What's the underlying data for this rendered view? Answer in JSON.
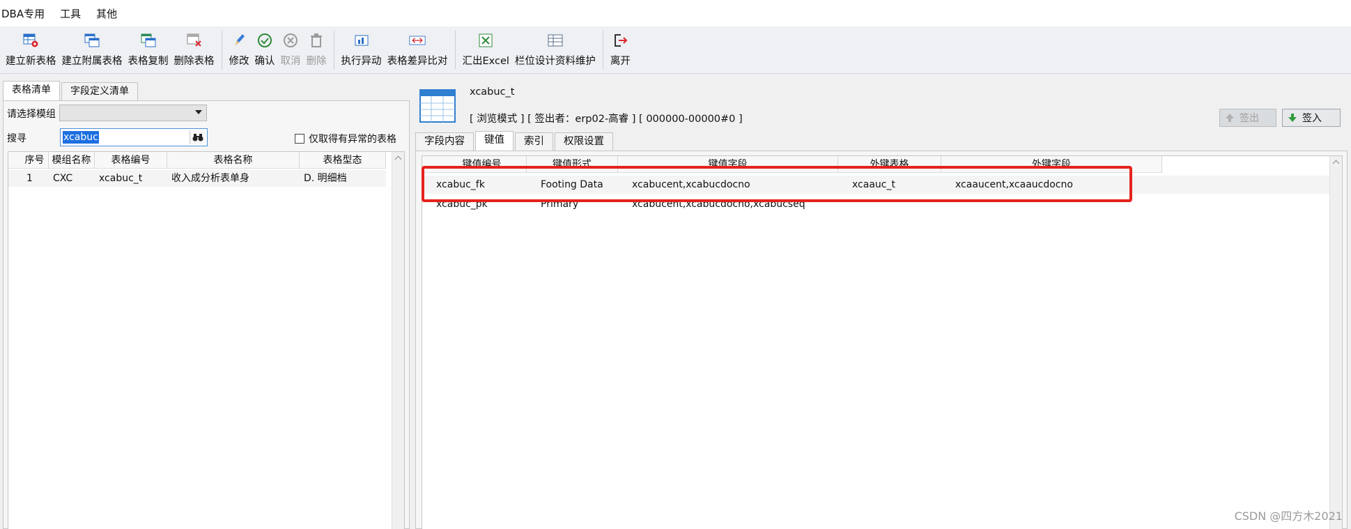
{
  "menu": [
    "DBA专用",
    "工具",
    "其他"
  ],
  "toolbar": {
    "groups": [
      [
        {
          "label": "建立新表格",
          "icon": "table-add-icon"
        },
        {
          "label": "建立附属表格",
          "icon": "table-attach-icon"
        },
        {
          "label": "表格复制",
          "icon": "table-copy-icon"
        },
        {
          "label": "删除表格",
          "icon": "table-delete-icon"
        }
      ],
      [
        {
          "label": "修改",
          "icon": "pencil-icon"
        },
        {
          "label": "确认",
          "icon": "check-icon"
        },
        {
          "label": "取消",
          "icon": "cancel-icon",
          "disabled": true
        },
        {
          "label": "删除",
          "icon": "trash-icon",
          "disabled": true
        }
      ],
      [
        {
          "label": "执行异动",
          "icon": "execute-icon"
        },
        {
          "label": "表格差异比对",
          "icon": "compare-icon"
        }
      ],
      [
        {
          "label": "汇出Excel",
          "icon": "excel-icon"
        },
        {
          "label": "栏位设计资料维护",
          "icon": "field-design-icon"
        }
      ],
      [
        {
          "label": "离开",
          "icon": "exit-icon"
        }
      ]
    ]
  },
  "left": {
    "tabs": [
      "表格清单",
      "字段定义清单"
    ],
    "module_label": "请选择模组",
    "module_value": "",
    "search_label": "搜寻",
    "search_value": "xcabuc",
    "abnormal_only_label": "仅取得有异常的表格",
    "abnormal_only_checked": false,
    "columns": [
      "序号",
      "模组名称",
      "表格编号",
      "表格名称",
      "表格型态"
    ],
    "rows": [
      [
        "1",
        "CXC",
        "xcabuc_t",
        "收入成分析表单身",
        "D. 明细档"
      ]
    ]
  },
  "right": {
    "table_name": "xcabuc_t",
    "status": "[ 浏览模式 ] [ 签出者：erp02-高睿 ] [ 000000-00000#0 ]",
    "checkout_label": "签出",
    "checkin_label": "签入",
    "tabs": [
      "字段内容",
      "键值",
      "索引",
      "权限设置"
    ],
    "active_tab": "键值",
    "columns": [
      "键值编号",
      "键值形式",
      "键值字段",
      "外键表格",
      "外键字段"
    ],
    "rows": [
      [
        "xcabuc_fk",
        "Footing Data",
        "xcabucent,xcabucdocno",
        "xcaauc_t",
        "xcaaucent,xcaaucdocno"
      ],
      [
        "xcabuc_pk",
        "Primary",
        "xcabucent,xcabucdocno,xcabucseq",
        "",
        ""
      ]
    ]
  },
  "watermark": "CSDN @四方木2021",
  "colors": {
    "highlight": "#e5231b",
    "selection": "#1c6fe0"
  }
}
